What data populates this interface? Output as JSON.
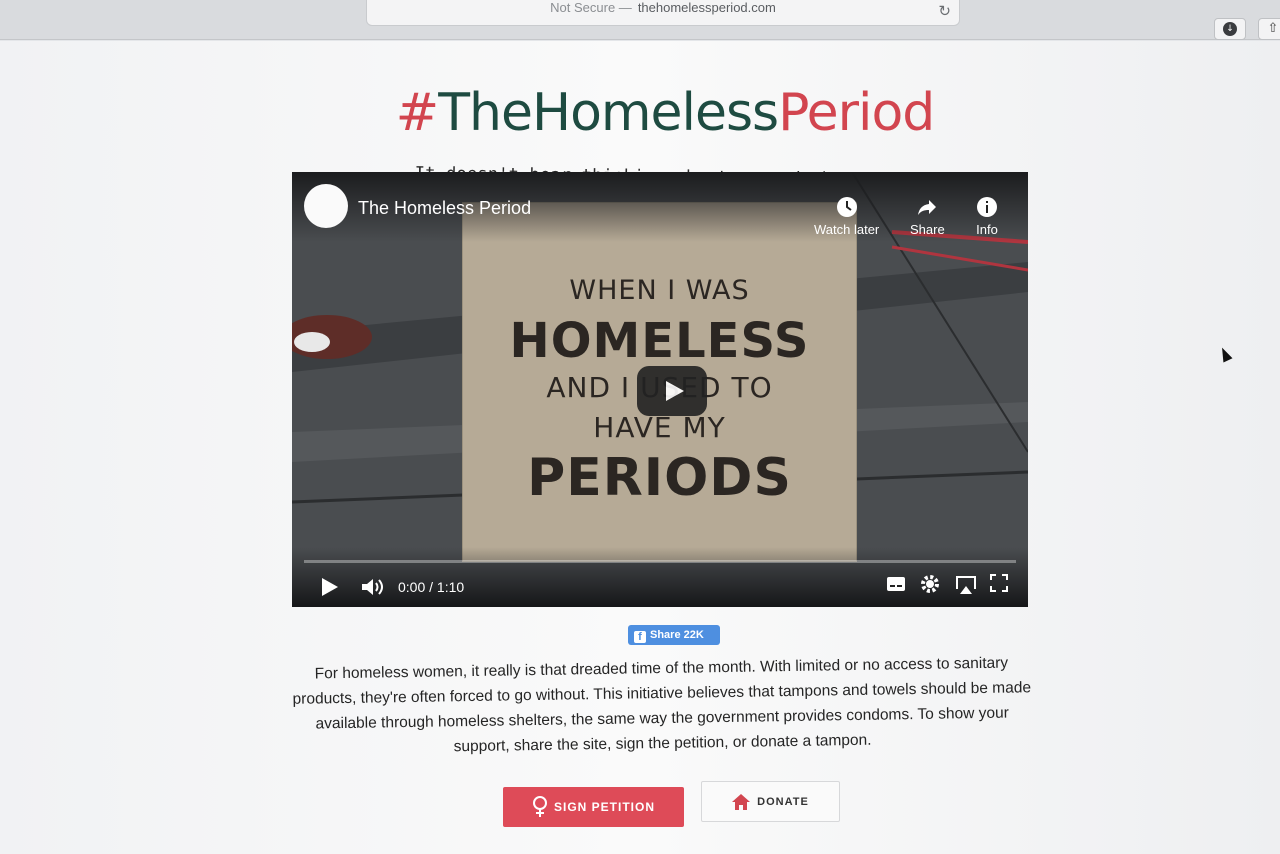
{
  "browser": {
    "url_security": "Not Secure —",
    "url": "thehomelessperiod.com"
  },
  "header": {
    "logo_hash": "#",
    "logo_dark": "TheHomeless",
    "logo_red": "Period",
    "tagline": "It doesn't bear thinking about... and that's the problem"
  },
  "video": {
    "title": "The Homeless Period",
    "actions": [
      {
        "label": "Watch later",
        "icon": "clock-icon"
      },
      {
        "label": "Share",
        "icon": "share-arrow-icon"
      },
      {
        "label": "Info",
        "icon": "info-icon"
      }
    ],
    "card_lines": [
      "WHEN I WAS",
      "HOMELESS",
      "AND I USED TO",
      "HAVE MY",
      "PERIODS"
    ],
    "time": "0:00 / 1:10"
  },
  "facebook": {
    "share_label": "Share 22K"
  },
  "description": "For homeless women, it really is that dreaded time of the month. With limited or no access to sanitary products, they're often forced to go without. This initiative believes that tampons and towels should be made available through homeless shelters, the same way the government provides condoms. To show your support, share the site, sign the petition, or donate a tampon.",
  "buttons": {
    "petition": "SIGN PETITION",
    "donate": "DONATE"
  },
  "colors": {
    "accent_red": "#de4b58",
    "logo_green": "#1e4b41",
    "facebook_blue": "#4e8fe0"
  }
}
